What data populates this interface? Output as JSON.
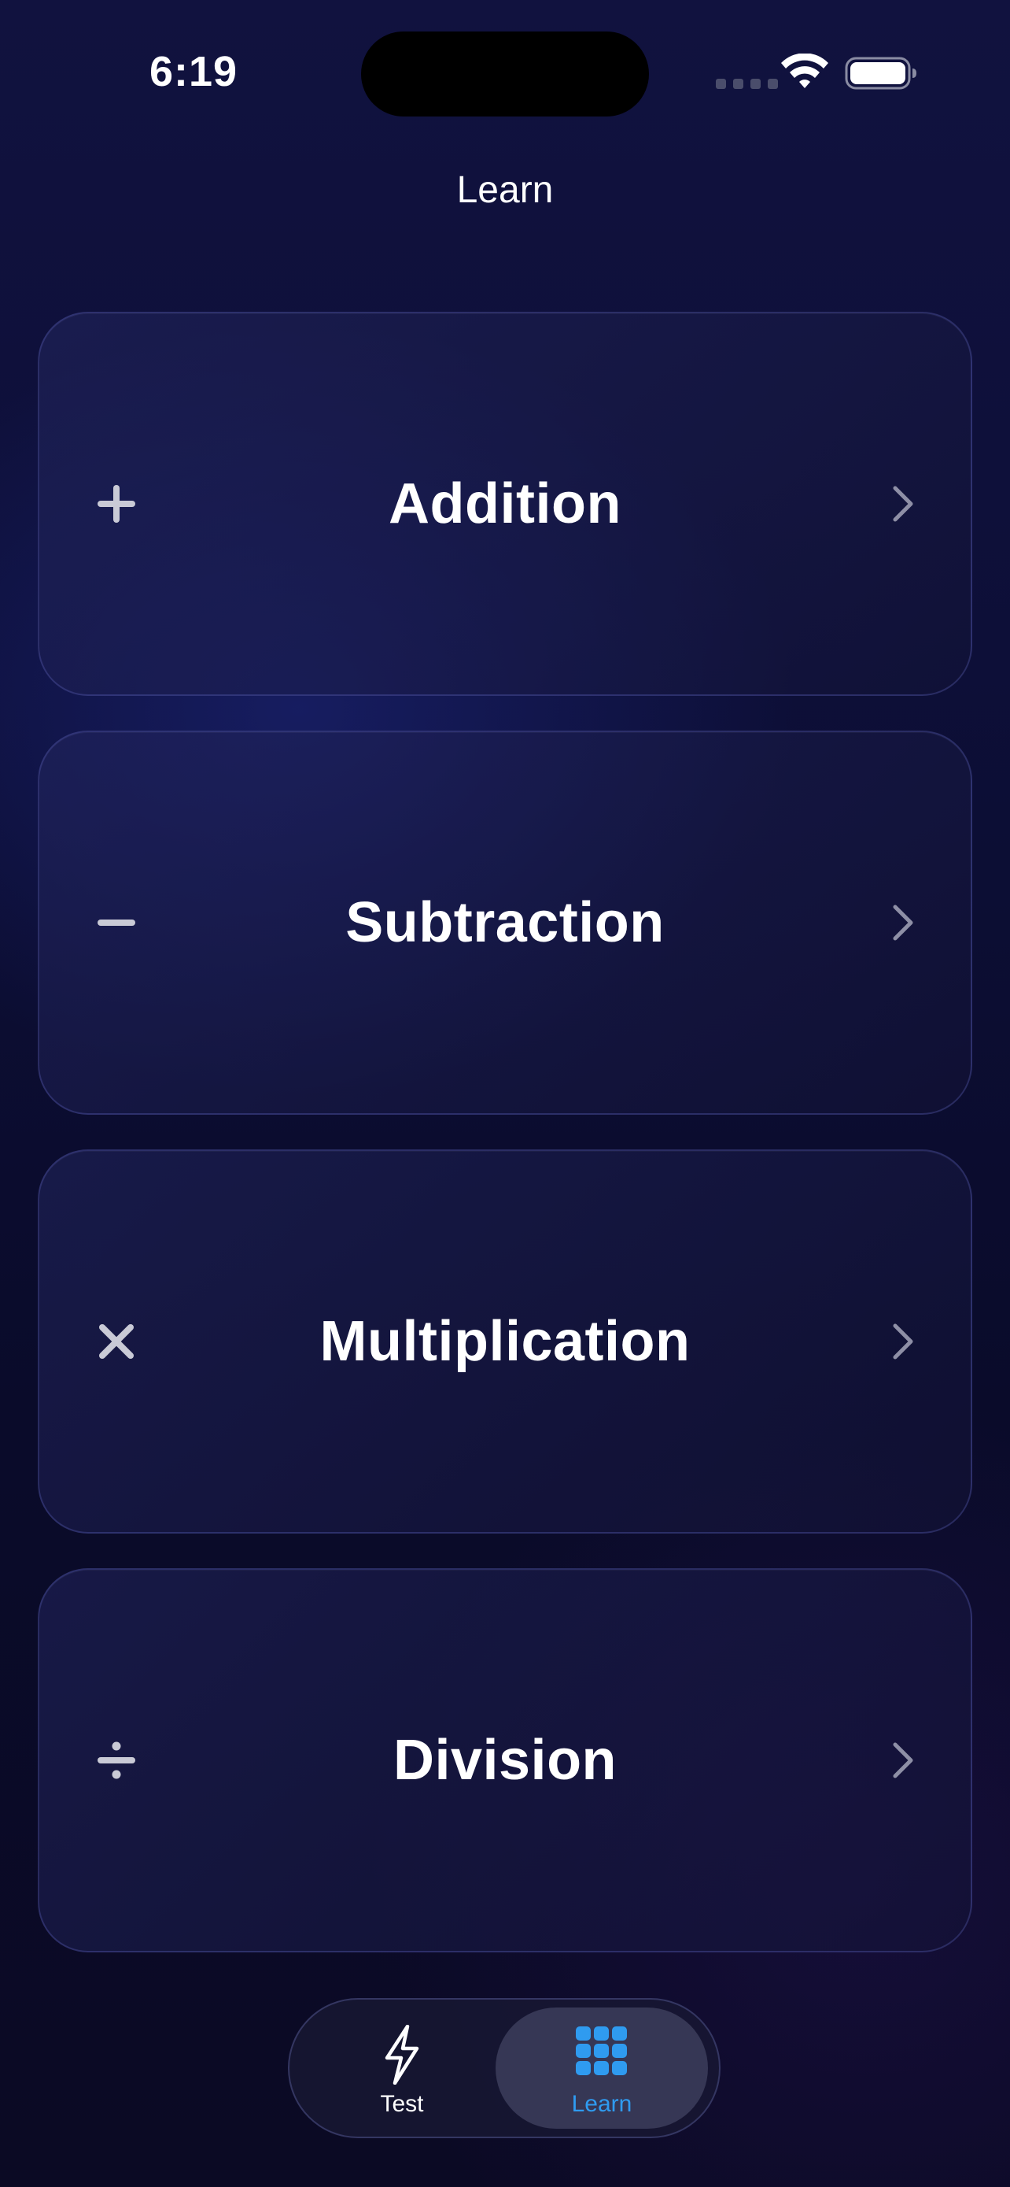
{
  "status_bar": {
    "time": "6:19",
    "icons": [
      "cellular-signal-icon",
      "wifi-icon",
      "battery-icon"
    ]
  },
  "header": {
    "title": "Learn"
  },
  "cards": [
    {
      "label": "Addition",
      "icon": "plus-icon"
    },
    {
      "label": "Subtraction",
      "icon": "minus-icon"
    },
    {
      "label": "Multiplication",
      "icon": "multiply-icon"
    },
    {
      "label": "Division",
      "icon": "divide-icon"
    }
  ],
  "tab_bar": {
    "selected": "Learn",
    "tabs": [
      {
        "label": "Test",
        "icon": "lightning-bolt-icon"
      },
      {
        "label": "Learn",
        "icon": "grid-icon"
      }
    ]
  },
  "colors": {
    "accent": "#2f9bf0",
    "background": "#0d0f38",
    "text": "#ffffff",
    "card_symbol": "#c9cad6",
    "chevron": "#8e8fa6"
  }
}
